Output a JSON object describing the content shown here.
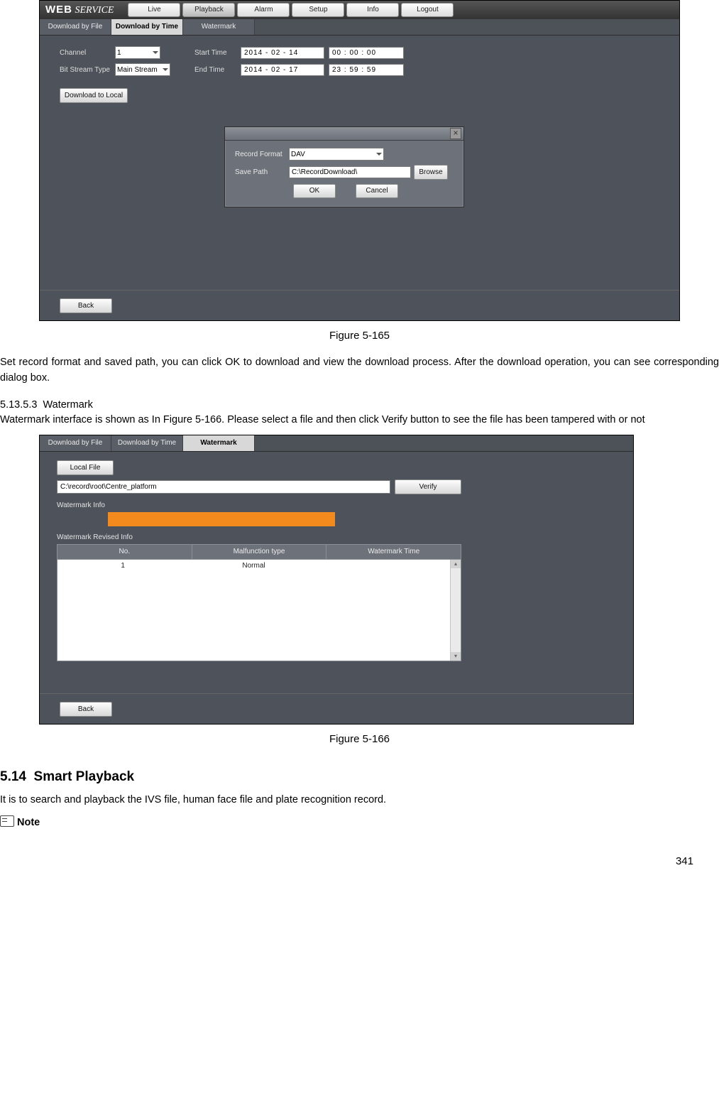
{
  "shot1": {
    "brand_bold": "WEB",
    "brand_italic": "SERVICE",
    "mainnav": [
      "Live",
      "Playback",
      "Alarm",
      "Setup",
      "Info",
      "Logout"
    ],
    "mainnav_active": 1,
    "subnav": [
      "Download by File",
      "Download by Time",
      "Watermark"
    ],
    "subnav_active": 1,
    "channel_label": "Channel",
    "channel_value": "1",
    "bitstream_label": "Bit Stream Type",
    "bitstream_value": "Main Stream",
    "starttime_label": "Start Time",
    "start_date": "2014 -  02  -  14",
    "start_time": "00  :  00  :  00",
    "endtime_label": "End Time",
    "end_date": "2014 -  02  -  17",
    "end_time": "23  :  59  :  59",
    "download_btn": "Download to Local",
    "dialog": {
      "recfmt_label": "Record Format",
      "recfmt_value": "DAV",
      "savepath_label": "Save Path",
      "savepath_value": "C:\\RecordDownload\\",
      "browse": "Browse",
      "ok": "OK",
      "cancel": "Cancel",
      "close": "×"
    },
    "back": "Back"
  },
  "caption1": "Figure 5-165",
  "para1": "Set record format and saved path, you can click OK to download and view the download process. After the download operation, you can see corresponding dialog box.",
  "subhead_num": "5.13.5.3",
  "subhead_txt": "Watermark",
  "para2": "Watermark interface is shown as In Figure 5-166. Please select a file and then click Verify button to see the file has been tampered with or not",
  "shot2": {
    "subnav": [
      "Download by File",
      "Download by Time",
      "Watermark"
    ],
    "subnav_active": 2,
    "local_file_btn": "Local File",
    "path_value": "C:\\record\\root\\Centre_platform",
    "verify_btn": "Verify",
    "wm_info_label": "Watermark Info",
    "wm_rev_label": "Watermark Revised Info",
    "thead": [
      "No.",
      "Malfunction type",
      "Watermark Time"
    ],
    "row": [
      "1",
      "Normal",
      ""
    ],
    "back": "Back"
  },
  "caption2": "Figure 5-166",
  "h2_num": "5.14",
  "h2_txt": "Smart Playback",
  "para3": "It is to search and playback the IVS file, human face file and plate recognition record.",
  "note_label": "Note",
  "pagenum": "341"
}
